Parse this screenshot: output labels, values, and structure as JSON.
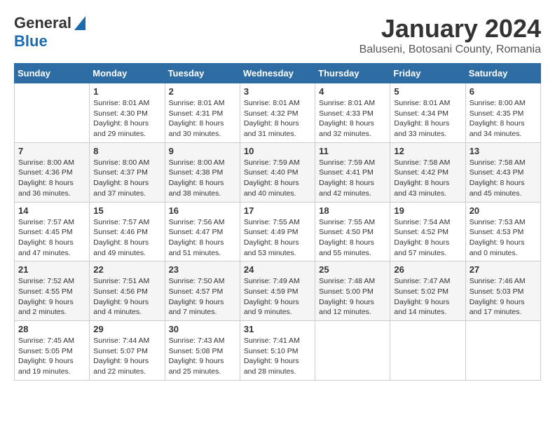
{
  "header": {
    "logo_general": "General",
    "logo_blue": "Blue",
    "month_title": "January 2024",
    "location": "Baluseni, Botosani County, Romania"
  },
  "weekdays": [
    "Sunday",
    "Monday",
    "Tuesday",
    "Wednesday",
    "Thursday",
    "Friday",
    "Saturday"
  ],
  "weeks": [
    [
      {
        "day": "",
        "info": ""
      },
      {
        "day": "1",
        "info": "Sunrise: 8:01 AM\nSunset: 4:30 PM\nDaylight: 8 hours\nand 29 minutes."
      },
      {
        "day": "2",
        "info": "Sunrise: 8:01 AM\nSunset: 4:31 PM\nDaylight: 8 hours\nand 30 minutes."
      },
      {
        "day": "3",
        "info": "Sunrise: 8:01 AM\nSunset: 4:32 PM\nDaylight: 8 hours\nand 31 minutes."
      },
      {
        "day": "4",
        "info": "Sunrise: 8:01 AM\nSunset: 4:33 PM\nDaylight: 8 hours\nand 32 minutes."
      },
      {
        "day": "5",
        "info": "Sunrise: 8:01 AM\nSunset: 4:34 PM\nDaylight: 8 hours\nand 33 minutes."
      },
      {
        "day": "6",
        "info": "Sunrise: 8:00 AM\nSunset: 4:35 PM\nDaylight: 8 hours\nand 34 minutes."
      }
    ],
    [
      {
        "day": "7",
        "info": "Sunrise: 8:00 AM\nSunset: 4:36 PM\nDaylight: 8 hours\nand 36 minutes."
      },
      {
        "day": "8",
        "info": "Sunrise: 8:00 AM\nSunset: 4:37 PM\nDaylight: 8 hours\nand 37 minutes."
      },
      {
        "day": "9",
        "info": "Sunrise: 8:00 AM\nSunset: 4:38 PM\nDaylight: 8 hours\nand 38 minutes."
      },
      {
        "day": "10",
        "info": "Sunrise: 7:59 AM\nSunset: 4:40 PM\nDaylight: 8 hours\nand 40 minutes."
      },
      {
        "day": "11",
        "info": "Sunrise: 7:59 AM\nSunset: 4:41 PM\nDaylight: 8 hours\nand 42 minutes."
      },
      {
        "day": "12",
        "info": "Sunrise: 7:58 AM\nSunset: 4:42 PM\nDaylight: 8 hours\nand 43 minutes."
      },
      {
        "day": "13",
        "info": "Sunrise: 7:58 AM\nSunset: 4:43 PM\nDaylight: 8 hours\nand 45 minutes."
      }
    ],
    [
      {
        "day": "14",
        "info": "Sunrise: 7:57 AM\nSunset: 4:45 PM\nDaylight: 8 hours\nand 47 minutes."
      },
      {
        "day": "15",
        "info": "Sunrise: 7:57 AM\nSunset: 4:46 PM\nDaylight: 8 hours\nand 49 minutes."
      },
      {
        "day": "16",
        "info": "Sunrise: 7:56 AM\nSunset: 4:47 PM\nDaylight: 8 hours\nand 51 minutes."
      },
      {
        "day": "17",
        "info": "Sunrise: 7:55 AM\nSunset: 4:49 PM\nDaylight: 8 hours\nand 53 minutes."
      },
      {
        "day": "18",
        "info": "Sunrise: 7:55 AM\nSunset: 4:50 PM\nDaylight: 8 hours\nand 55 minutes."
      },
      {
        "day": "19",
        "info": "Sunrise: 7:54 AM\nSunset: 4:52 PM\nDaylight: 8 hours\nand 57 minutes."
      },
      {
        "day": "20",
        "info": "Sunrise: 7:53 AM\nSunset: 4:53 PM\nDaylight: 9 hours\nand 0 minutes."
      }
    ],
    [
      {
        "day": "21",
        "info": "Sunrise: 7:52 AM\nSunset: 4:55 PM\nDaylight: 9 hours\nand 2 minutes."
      },
      {
        "day": "22",
        "info": "Sunrise: 7:51 AM\nSunset: 4:56 PM\nDaylight: 9 hours\nand 4 minutes."
      },
      {
        "day": "23",
        "info": "Sunrise: 7:50 AM\nSunset: 4:57 PM\nDaylight: 9 hours\nand 7 minutes."
      },
      {
        "day": "24",
        "info": "Sunrise: 7:49 AM\nSunset: 4:59 PM\nDaylight: 9 hours\nand 9 minutes."
      },
      {
        "day": "25",
        "info": "Sunrise: 7:48 AM\nSunset: 5:00 PM\nDaylight: 9 hours\nand 12 minutes."
      },
      {
        "day": "26",
        "info": "Sunrise: 7:47 AM\nSunset: 5:02 PM\nDaylight: 9 hours\nand 14 minutes."
      },
      {
        "day": "27",
        "info": "Sunrise: 7:46 AM\nSunset: 5:03 PM\nDaylight: 9 hours\nand 17 minutes."
      }
    ],
    [
      {
        "day": "28",
        "info": "Sunrise: 7:45 AM\nSunset: 5:05 PM\nDaylight: 9 hours\nand 19 minutes."
      },
      {
        "day": "29",
        "info": "Sunrise: 7:44 AM\nSunset: 5:07 PM\nDaylight: 9 hours\nand 22 minutes."
      },
      {
        "day": "30",
        "info": "Sunrise: 7:43 AM\nSunset: 5:08 PM\nDaylight: 9 hours\nand 25 minutes."
      },
      {
        "day": "31",
        "info": "Sunrise: 7:41 AM\nSunset: 5:10 PM\nDaylight: 9 hours\nand 28 minutes."
      },
      {
        "day": "",
        "info": ""
      },
      {
        "day": "",
        "info": ""
      },
      {
        "day": "",
        "info": ""
      }
    ]
  ]
}
